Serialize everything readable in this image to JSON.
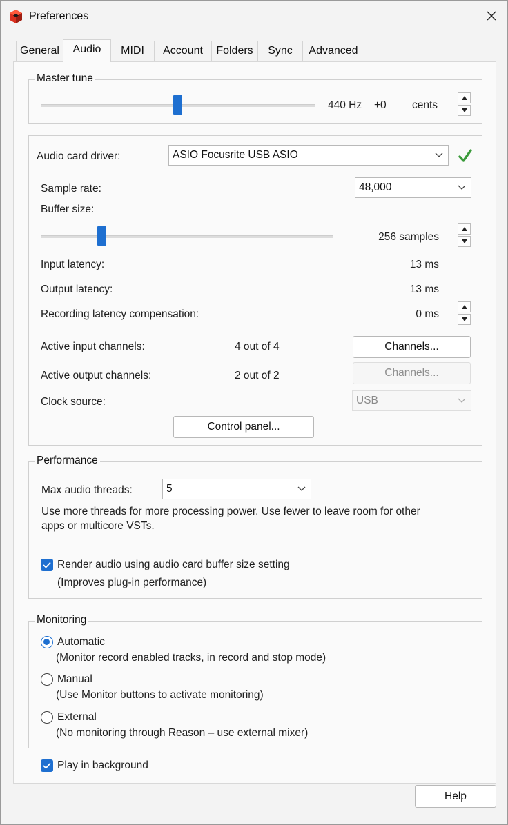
{
  "window": {
    "title": "Preferences"
  },
  "tabs": [
    {
      "label": "General"
    },
    {
      "label": "Audio"
    },
    {
      "label": "MIDI"
    },
    {
      "label": "Account"
    },
    {
      "label": "Folders"
    },
    {
      "label": "Sync"
    },
    {
      "label": "Advanced"
    }
  ],
  "active_tab": "Audio",
  "master_tune": {
    "legend": "Master tune",
    "hz": "440 Hz",
    "offset": "+0",
    "unit": "cents",
    "slider_fraction": 0.49
  },
  "audio": {
    "driver_label": "Audio card driver:",
    "driver_value": "ASIO Focusrite USB ASIO",
    "sample_rate_label": "Sample rate:",
    "sample_rate_value": "48,000",
    "buffer_label": "Buffer size:",
    "buffer_value": "256 samples",
    "buffer_slider_fraction": 0.2,
    "input_latency_label": "Input latency:",
    "input_latency_value": "13 ms",
    "output_latency_label": "Output latency:",
    "output_latency_value": "13 ms",
    "rec_comp_label": "Recording latency compensation:",
    "rec_comp_value": "0 ms",
    "active_in_label": "Active input channels:",
    "active_in_value": "4 out of 4",
    "active_out_label": "Active output channels:",
    "active_out_value": "2 out of 2",
    "channels_btn": "Channels...",
    "channels_btn_disabled": "Channels...",
    "clock_label": "Clock source:",
    "clock_value": "USB",
    "control_panel_btn": "Control panel..."
  },
  "performance": {
    "legend": "Performance",
    "threads_label": "Max audio threads:",
    "threads_value": "5",
    "help_line1": "Use more threads for more processing power. Use fewer to leave room for other",
    "help_line2": "apps or multicore VSTs.",
    "render_label": "Render audio using audio card buffer size setting",
    "render_note": "(Improves plug-in performance)",
    "render_checked": true
  },
  "monitoring": {
    "legend": "Monitoring",
    "options": [
      {
        "label": "Automatic",
        "note": "(Monitor record enabled tracks, in record and stop mode)",
        "selected": true
      },
      {
        "label": "Manual",
        "note": "(Use Monitor buttons to activate monitoring)",
        "selected": false
      },
      {
        "label": "External",
        "note": "(No monitoring through Reason – use external mixer)",
        "selected": false
      }
    ]
  },
  "play_background": {
    "label": "Play in background",
    "checked": true
  },
  "help_btn": "Help",
  "colors": {
    "accent": "#1e6fd0",
    "ok_check": "#3b9b3b",
    "app_icon": "#d9301f"
  }
}
